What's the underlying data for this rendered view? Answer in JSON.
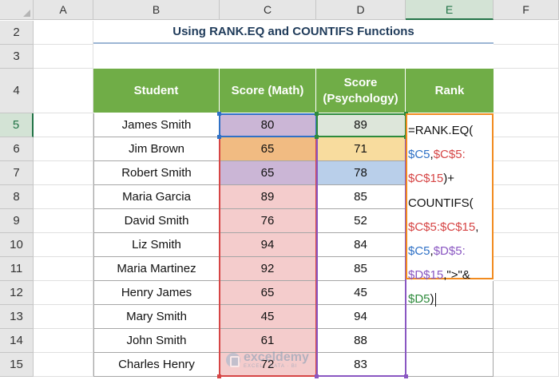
{
  "spreadsheet": {
    "columns": [
      "A",
      "B",
      "C",
      "D",
      "E",
      "F"
    ],
    "selected_column": "E",
    "rows": [
      "2",
      "3",
      "4",
      "5",
      "6",
      "7",
      "8",
      "9",
      "10",
      "11",
      "12",
      "13",
      "14",
      "15"
    ],
    "selected_row": "5",
    "title": "Using RANK.EQ and COUNTIFS Functions",
    "headers": {
      "student": "Student",
      "score_math": "Score (Math)",
      "score_psych_line1": "Score",
      "score_psych_line2": "(Psychology)",
      "rank": "Rank"
    },
    "records": [
      {
        "student": "James Smith",
        "math": "80",
        "psych": "89"
      },
      {
        "student": "Jim Brown",
        "math": "65",
        "psych": "71"
      },
      {
        "student": "Robert Smith",
        "math": "65",
        "psych": "78"
      },
      {
        "student": "Maria Garcia",
        "math": "89",
        "psych": "85"
      },
      {
        "student": "David Smith",
        "math": "76",
        "psych": "52"
      },
      {
        "student": "Liz Smith",
        "math": "94",
        "psych": "84"
      },
      {
        "student": "Maria Martinez",
        "math": "92",
        "psych": "85"
      },
      {
        "student": "Henry James",
        "math": "65",
        "psych": "45"
      },
      {
        "student": "Mary Smith",
        "math": "45",
        "psych": "94"
      },
      {
        "student": "John Smith",
        "math": "61",
        "psych": "88"
      },
      {
        "student": "Charles Henry",
        "math": "72",
        "psych": "83"
      }
    ],
    "formula_lines": [
      [
        {
          "t": "=RANK.EQ(",
          "c": "default"
        }
      ],
      [
        {
          "t": "$C5",
          "c": "blue"
        },
        {
          "t": ",",
          "c": "default"
        },
        {
          "t": "$C$5:",
          "c": "red"
        }
      ],
      [
        {
          "t": "$C$15",
          "c": "red"
        },
        {
          "t": ")+",
          "c": "default"
        }
      ],
      [
        {
          "t": "COUNTIFS(",
          "c": "default"
        }
      ],
      [
        {
          "t": "$C$5:$C$15",
          "c": "red"
        },
        {
          "t": ",",
          "c": "default"
        }
      ],
      [
        {
          "t": "$C5",
          "c": "blue"
        },
        {
          "t": ",",
          "c": "default"
        },
        {
          "t": "$D$5:",
          "c": "purple"
        }
      ],
      [
        {
          "t": "$D$15",
          "c": "purple"
        },
        {
          "t": ",\">\"&",
          "c": "default"
        }
      ],
      [
        {
          "t": "$D5",
          "c": "green"
        },
        {
          "t": ")",
          "c": "default"
        }
      ]
    ],
    "watermark": {
      "name": "exceldemy",
      "tagline": "EXCEL · DATA · BI"
    }
  },
  "colors": {
    "header_green": "#70ad47",
    "math_range_red": "#f4cccc",
    "math_hl_purple": "#cbb6d6",
    "math_hl_orange": "#f1bb82",
    "psych_hl_green": "#dde6da",
    "psych_hl_yellow": "#f8dc9e",
    "psych_hl_blue": "#b9cfea",
    "formula_border": "#f28b1f"
  }
}
